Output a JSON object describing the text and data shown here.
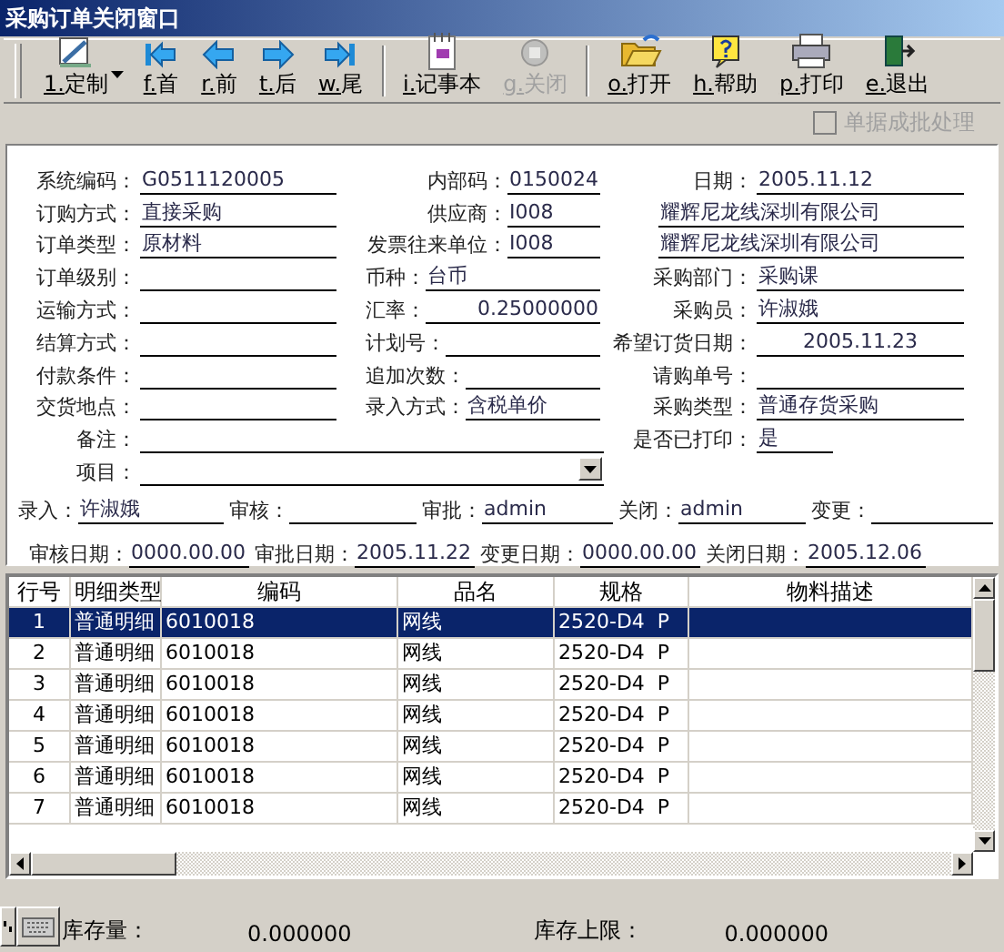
{
  "window": {
    "title": "采购订单关闭窗口"
  },
  "toolbar": [
    {
      "key": "1.",
      "label": "定制",
      "disabled": false,
      "kind": "menu"
    },
    {
      "key": "f.",
      "label": "首",
      "disabled": false,
      "kind": "button"
    },
    {
      "key": "r.",
      "label": "前",
      "disabled": false,
      "kind": "button"
    },
    {
      "key": "t.",
      "label": "后",
      "disabled": false,
      "kind": "button"
    },
    {
      "key": "w.",
      "label": "尾",
      "disabled": false,
      "kind": "button"
    },
    {
      "key": "i.",
      "label": "记事本",
      "disabled": false,
      "kind": "button"
    },
    {
      "key": "g.",
      "label": "关闭",
      "disabled": true,
      "kind": "button"
    },
    {
      "key": "o.",
      "label": "打开",
      "disabled": false,
      "kind": "button"
    },
    {
      "key": "h.",
      "label": "帮助",
      "disabled": false,
      "kind": "button"
    },
    {
      "key": "p.",
      "label": "打印",
      "disabled": false,
      "kind": "button"
    },
    {
      "key": "e.",
      "label": "退出",
      "disabled": false,
      "kind": "button"
    }
  ],
  "batch_option": {
    "label": "单据成批处理",
    "checked": false,
    "disabled": true
  },
  "form": {
    "rows": [
      [
        {
          "label": "系统编码：",
          "value": "G0511120005",
          "kind": "text"
        },
        {
          "label": "内部码：",
          "value": "0150024",
          "kind": "text"
        },
        {
          "label": "日期：",
          "value": "2005.11.12",
          "kind": "text"
        }
      ],
      [
        {
          "label": "订购方式：",
          "value": "直接采购",
          "kind": "text"
        },
        {
          "label": "供应商：",
          "value": "I008",
          "kind": "text"
        },
        {
          "value": "耀辉尼龙线深圳有限公司",
          "kind": "text"
        }
      ],
      [
        {
          "label": "订单类型：",
          "value": "原材料",
          "kind": "text"
        },
        {
          "label": "发票往来单位：",
          "value": "I008",
          "kind": "text"
        },
        {
          "value": "耀辉尼龙线深圳有限公司",
          "kind": "text"
        }
      ],
      [
        {
          "label": "订单级别：",
          "kind": "text"
        },
        {
          "label": "币种：",
          "value": "台币",
          "kind": "text"
        },
        {
          "label": "采购部门：",
          "value": "采购课",
          "kind": "text"
        }
      ],
      [
        {
          "label": "运输方式：",
          "kind": "text"
        },
        {
          "label": "汇率：",
          "value": "0.25000000",
          "kind": "text"
        },
        {
          "label": "采购员：",
          "value": "许淑娥",
          "kind": "text"
        }
      ],
      [
        {
          "label": "结算方式：",
          "kind": "text"
        },
        {
          "label": "计划号：",
          "kind": "text"
        },
        {
          "label": "希望订货日期：",
          "value": "2005.11.23",
          "kind": "text"
        }
      ],
      [
        {
          "label": "付款条件：",
          "kind": "text"
        },
        {
          "label": "追加次数：",
          "kind": "text"
        },
        {
          "label": "请购单号：",
          "kind": "text"
        }
      ],
      [
        {
          "label": "交货地点：",
          "kind": "text"
        },
        {
          "label": "录入方式：",
          "value": "含税单价",
          "kind": "text"
        },
        {
          "label": "采购类型：",
          "value": "普通存货采购",
          "kind": "text"
        }
      ],
      [
        {
          "label": "备注：",
          "kind": "text"
        },
        null,
        {
          "label": "是否已打印：",
          "value": "是",
          "kind": "text"
        }
      ],
      [
        {
          "label": "项目：",
          "kind": "dropdown"
        }
      ]
    ],
    "audit_rows": [
      [
        {
          "label": "录入：",
          "value": "许淑娥"
        },
        {
          "label": "审核："
        },
        {
          "label": "审批：",
          "value": "admin"
        },
        {
          "label": "关闭：",
          "value": "admin"
        },
        {
          "label": "变更："
        }
      ],
      [
        {
          "label": "审核日期：",
          "value": "0000.00.00"
        },
        {
          "label": "审批日期：",
          "value": "2005.11.22"
        },
        {
          "label": "变更日期：",
          "value": "0000.00.00"
        },
        {
          "label": "关闭日期：",
          "value": "2005.12.06"
        }
      ]
    ]
  },
  "table": {
    "columns": [
      "行号",
      "明细类型",
      "编码",
      "品名",
      "规格",
      "物料描述"
    ],
    "rows": [
      {
        "cells": [
          "1",
          "普通明细",
          "6010018",
          "网线",
          "2520-D4  P",
          ""
        ],
        "selected": true
      },
      {
        "cells": [
          "2",
          "普通明细",
          "6010018",
          "网线",
          "2520-D4  P",
          ""
        ],
        "selected": false
      },
      {
        "cells": [
          "3",
          "普通明细",
          "6010018",
          "网线",
          "2520-D4  P",
          ""
        ],
        "selected": false
      },
      {
        "cells": [
          "4",
          "普通明细",
          "6010018",
          "网线",
          "2520-D4  P",
          ""
        ],
        "selected": false
      },
      {
        "cells": [
          "5",
          "普通明细",
          "6010018",
          "网线",
          "2520-D4  P",
          ""
        ],
        "selected": false
      },
      {
        "cells": [
          "6",
          "普通明细",
          "6010018",
          "网线",
          "2520-D4  P",
          ""
        ],
        "selected": false
      },
      {
        "cells": [
          "7",
          "普通明细",
          "6010018",
          "网线",
          "2520-D4  P",
          ""
        ],
        "selected": false
      }
    ]
  },
  "stock": [
    {
      "label": "库存量：",
      "value": "0.000000"
    },
    {
      "label": "库存上限：",
      "value": "0.000000"
    }
  ]
}
